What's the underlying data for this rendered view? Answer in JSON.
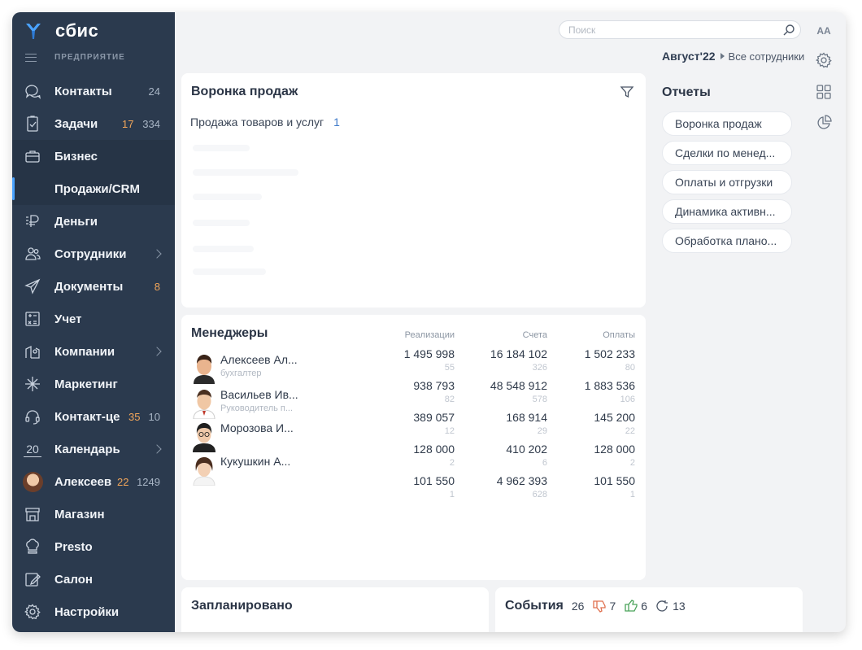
{
  "brand": {
    "name": "сбис",
    "section": "ПРЕДПРИЯТИЕ"
  },
  "sidebar": {
    "items": [
      {
        "label": "Контакты",
        "count": "24"
      },
      {
        "label": "Задачи",
        "count_orange": "17",
        "count": "334"
      },
      {
        "label": "Бизнес"
      },
      {
        "label": "Продажи/CRM"
      },
      {
        "label": "Деньги"
      },
      {
        "label": "Сотрудники"
      },
      {
        "label": "Документы",
        "count_orange": "8"
      },
      {
        "label": "Учет"
      },
      {
        "label": "Компании"
      },
      {
        "label": "Маркетинг"
      },
      {
        "label": "Контакт-це",
        "count_orange": "35",
        "count": "10"
      },
      {
        "label": "Календарь",
        "icon_text": "20"
      },
      {
        "label": "Алексеев",
        "count_orange": "22",
        "count": "1249"
      },
      {
        "label": "Магазин"
      },
      {
        "label": "Presto"
      },
      {
        "label": "Салон"
      },
      {
        "label": "Настройки"
      }
    ]
  },
  "topbar": {
    "search_placeholder": "Поиск",
    "font_toggle": "AA",
    "period_month": "Август'22",
    "period_scope": "Все сотрудники"
  },
  "funnel": {
    "title": "Воронка продаж",
    "row_label": "Продажа товаров и услуг",
    "row_value": "1"
  },
  "reports": {
    "title": "Отчеты",
    "items": [
      "Воронка продаж",
      "Сделки по менед...",
      "Оплаты и отгрузки",
      "Динамика активн...",
      "Обработка плано..."
    ]
  },
  "managers": {
    "title": "Менеджеры",
    "columns": [
      "Реализации",
      "Счета",
      "Оплаты"
    ],
    "people": [
      {
        "name": "Алексеев Ал...",
        "role": "бухгалтер"
      },
      {
        "name": "Васильев Ив...",
        "role": "Руководитель п..."
      },
      {
        "name": "Морозова И...",
        "role": ""
      },
      {
        "name": "Кукушкин А...",
        "role": ""
      }
    ],
    "rows": [
      {
        "real": "1 495 998",
        "real_n": "55",
        "bills": "16 184 102",
        "bills_n": "326",
        "pay": "1 502 233",
        "pay_n": "80"
      },
      {
        "real": "938 793",
        "real_n": "82",
        "bills": "48 548 912",
        "bills_n": "578",
        "pay": "1 883 536",
        "pay_n": "106"
      },
      {
        "real": "389 057",
        "real_n": "12",
        "bills": "168 914",
        "bills_n": "29",
        "pay": "145 200",
        "pay_n": "22"
      },
      {
        "real": "128 000",
        "real_n": "2",
        "bills": "410 202",
        "bills_n": "6",
        "pay": "128 000",
        "pay_n": "2"
      },
      {
        "real": "101 550",
        "real_n": "1",
        "bills": "4 962 393",
        "bills_n": "628",
        "pay": "101 550",
        "pay_n": "1"
      }
    ]
  },
  "planned": {
    "title": "Запланировано"
  },
  "events": {
    "title": "События",
    "total": "26",
    "dislikes": "7",
    "likes": "6",
    "repeats": "13"
  },
  "colors": {
    "sidebar_bg": "#2b3a4e",
    "accent": "#4aa3ff",
    "orange": "#f2a65a",
    "link": "#3f7ac9"
  }
}
